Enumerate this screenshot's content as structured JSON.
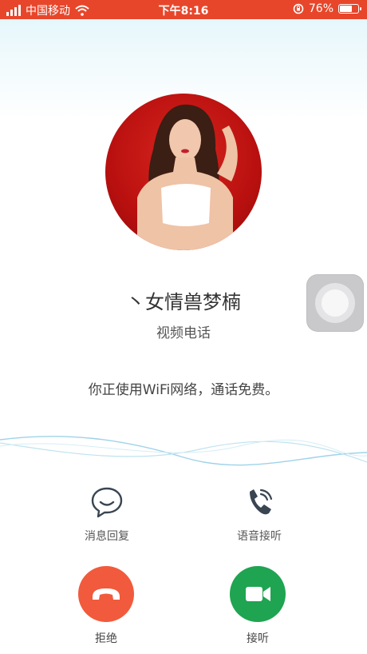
{
  "status_bar": {
    "carrier": "中国移动",
    "time": "下午8:16",
    "battery": "76%",
    "signal_icon": "signal-bars-icon",
    "wifi_icon": "wifi-icon",
    "rotation_lock_icon": "rotation-lock-icon",
    "battery_icon": "battery-icon",
    "battery_level": 0.76,
    "bar_color": "#e8462b"
  },
  "caller": {
    "name": "丶女情兽梦楠",
    "call_type": "视频电话",
    "notice": "你正使用WiFi网络，通话免费。"
  },
  "actions": {
    "message_reply": {
      "label": "消息回复",
      "icon": "chat-bubble-icon"
    },
    "voice_answer": {
      "label": "语音接听",
      "icon": "phone-voice-icon"
    },
    "decline": {
      "label": "拒绝",
      "icon": "hang-up-icon",
      "color": "#f15a3c"
    },
    "accept": {
      "label": "接听",
      "icon": "video-camera-icon",
      "color": "#1fa451"
    }
  },
  "assistive_touch": {
    "icon": "assistive-touch-icon"
  }
}
